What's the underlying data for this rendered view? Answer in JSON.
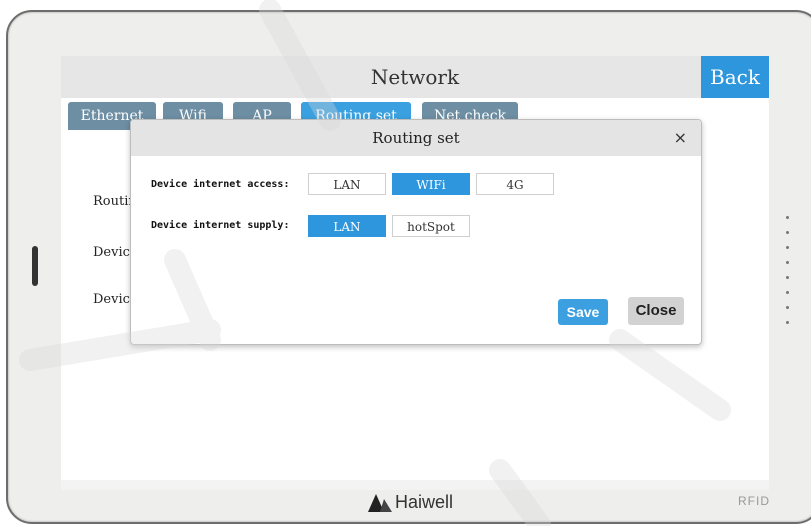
{
  "window": {
    "title": "Network",
    "back_label": "Back"
  },
  "tabs": [
    {
      "label": "Ethernet",
      "active": false
    },
    {
      "label": "Wifi",
      "active": false
    },
    {
      "label": "AP",
      "active": false
    },
    {
      "label": "Routing set",
      "active": true
    },
    {
      "label": "Net check",
      "active": false
    }
  ],
  "background_labels": [
    "Routing",
    "Device",
    "Device"
  ],
  "dialog": {
    "title": "Routing set",
    "close_glyph": "×",
    "rows": [
      {
        "label": "Device internet access:",
        "options": [
          {
            "label": "LAN",
            "selected": false
          },
          {
            "label": "WIFi",
            "selected": true
          },
          {
            "label": "4G",
            "selected": false
          }
        ]
      },
      {
        "label": "Device internet supply:",
        "options": [
          {
            "label": "LAN",
            "selected": true
          },
          {
            "label": "hotSpot",
            "selected": false
          }
        ]
      }
    ],
    "save_label": "Save",
    "close_label": "Close"
  },
  "footer": {
    "brand": "Haiwell",
    "rfid": "RFID"
  },
  "colors": {
    "accent": "#2e96dd",
    "tab": "#6d8ea3",
    "titlebar": "#e6e6e6"
  },
  "watermark": "Haiwell"
}
